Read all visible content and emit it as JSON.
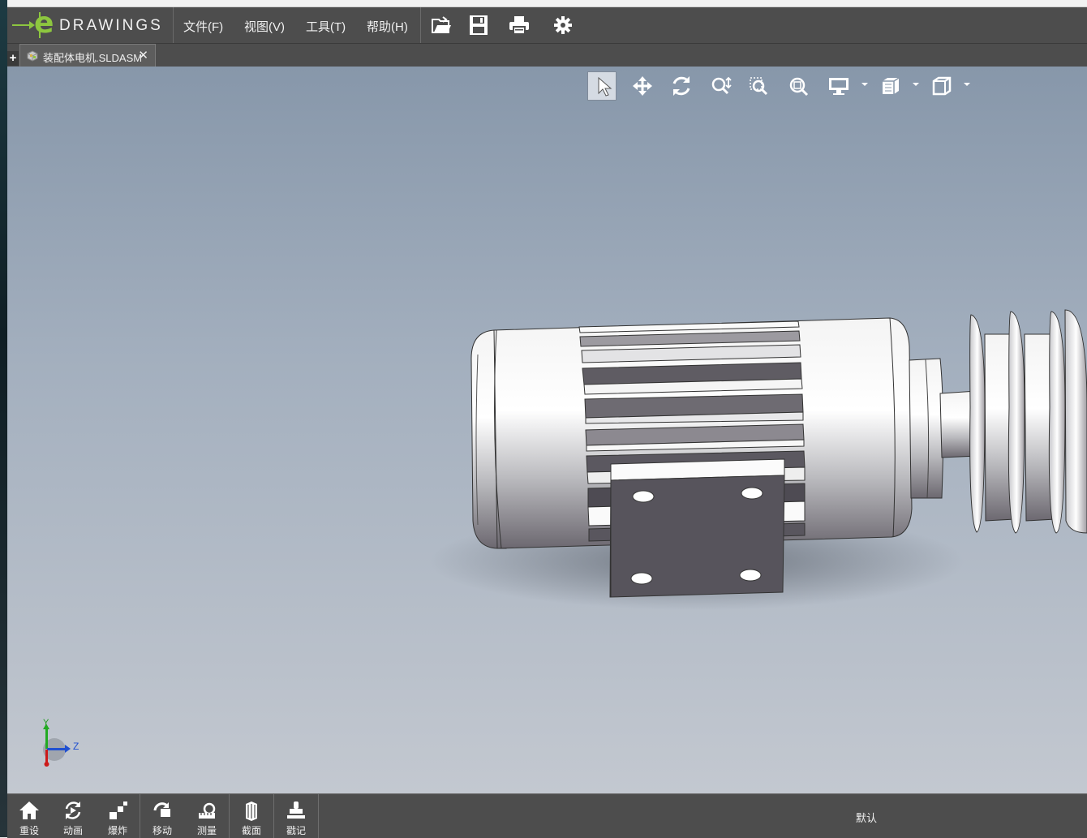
{
  "app": {
    "logo_text": "DRAWINGS",
    "logo_letter": "e",
    "brand_color": "#8dc63f"
  },
  "menu": {
    "file": "文件(F)",
    "view": "视图(V)",
    "tools": "工具(T)",
    "help": "帮助(H)"
  },
  "toolbar_icons": [
    "open-icon",
    "save-icon",
    "print-icon",
    "settings-icon"
  ],
  "tabs": [
    {
      "label": "装配体电机.SLDASM",
      "close": "✕"
    }
  ],
  "new_tab_label": "+",
  "view_tools": [
    "select-icon",
    "pan-icon",
    "rotate-icon",
    "zoom-icon",
    "zoom-to-area-icon",
    "zoom-to-fit-icon",
    "display-style-icon",
    "view-orientation-icon",
    "standard-views-icon"
  ],
  "triad": {
    "y": "Y",
    "z": "Z"
  },
  "bottom_toolbar": [
    {
      "label": "重设",
      "icon": "home-icon"
    },
    {
      "label": "动画",
      "icon": "animate-icon"
    },
    {
      "label": "爆炸",
      "icon": "explode-icon"
    },
    {
      "label": "移动",
      "icon": "move-icon"
    },
    {
      "label": "测量",
      "icon": "measure-icon"
    },
    {
      "label": "截面",
      "icon": "section-icon"
    },
    {
      "label": "戳记",
      "icon": "stamp-icon"
    }
  ],
  "configuration": "默认"
}
